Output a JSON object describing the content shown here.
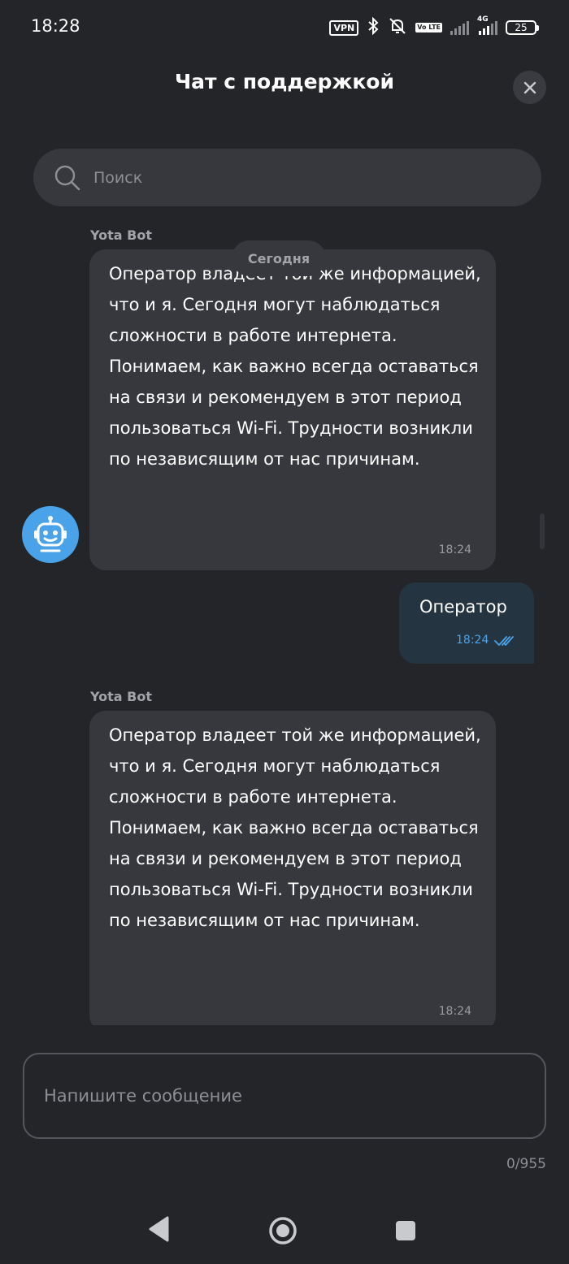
{
  "status_bar": {
    "time": "18:28",
    "vpn": "VPN",
    "volte": "Vo LTE",
    "network": "4G",
    "battery": "25"
  },
  "header": {
    "title": "Чат с поддержкой",
    "close_icon": "close-icon"
  },
  "search": {
    "placeholder": "Поиск",
    "icon": "search-icon"
  },
  "date_chip": "Сегодня",
  "messages": [
    {
      "sender": "Yota Bot",
      "text": "Оператор владеет той же информацией, что и я. Сегодня могут наблюдаться сложности в работе интернета. Понимаем, как важно всегда оставаться на связи и рекомендуем в этот период пользоваться Wi-Fi. Трудности возникли по независящим от нас причинам.",
      "time": "18:24"
    },
    {
      "sender": "",
      "text": "Оператор",
      "time": "18:24",
      "status": "read"
    },
    {
      "sender": "Yota Bot",
      "text": "Оператор владеет той же информацией, что и я. Сегодня могут наблюдаться сложности в работе интернета. Понимаем, как важно всегда оставаться на связи и рекомендуем в этот период пользоваться Wi-Fi. Трудности возникли по независящим от нас причинам.",
      "time": "18:24"
    }
  ],
  "composer": {
    "placeholder": "Напишите сообщение",
    "counter": "0/955"
  },
  "colors": {
    "background": "#242529",
    "bubble_in": "#37383e",
    "bubble_out": "#243541",
    "accent": "#4aa3e8"
  }
}
